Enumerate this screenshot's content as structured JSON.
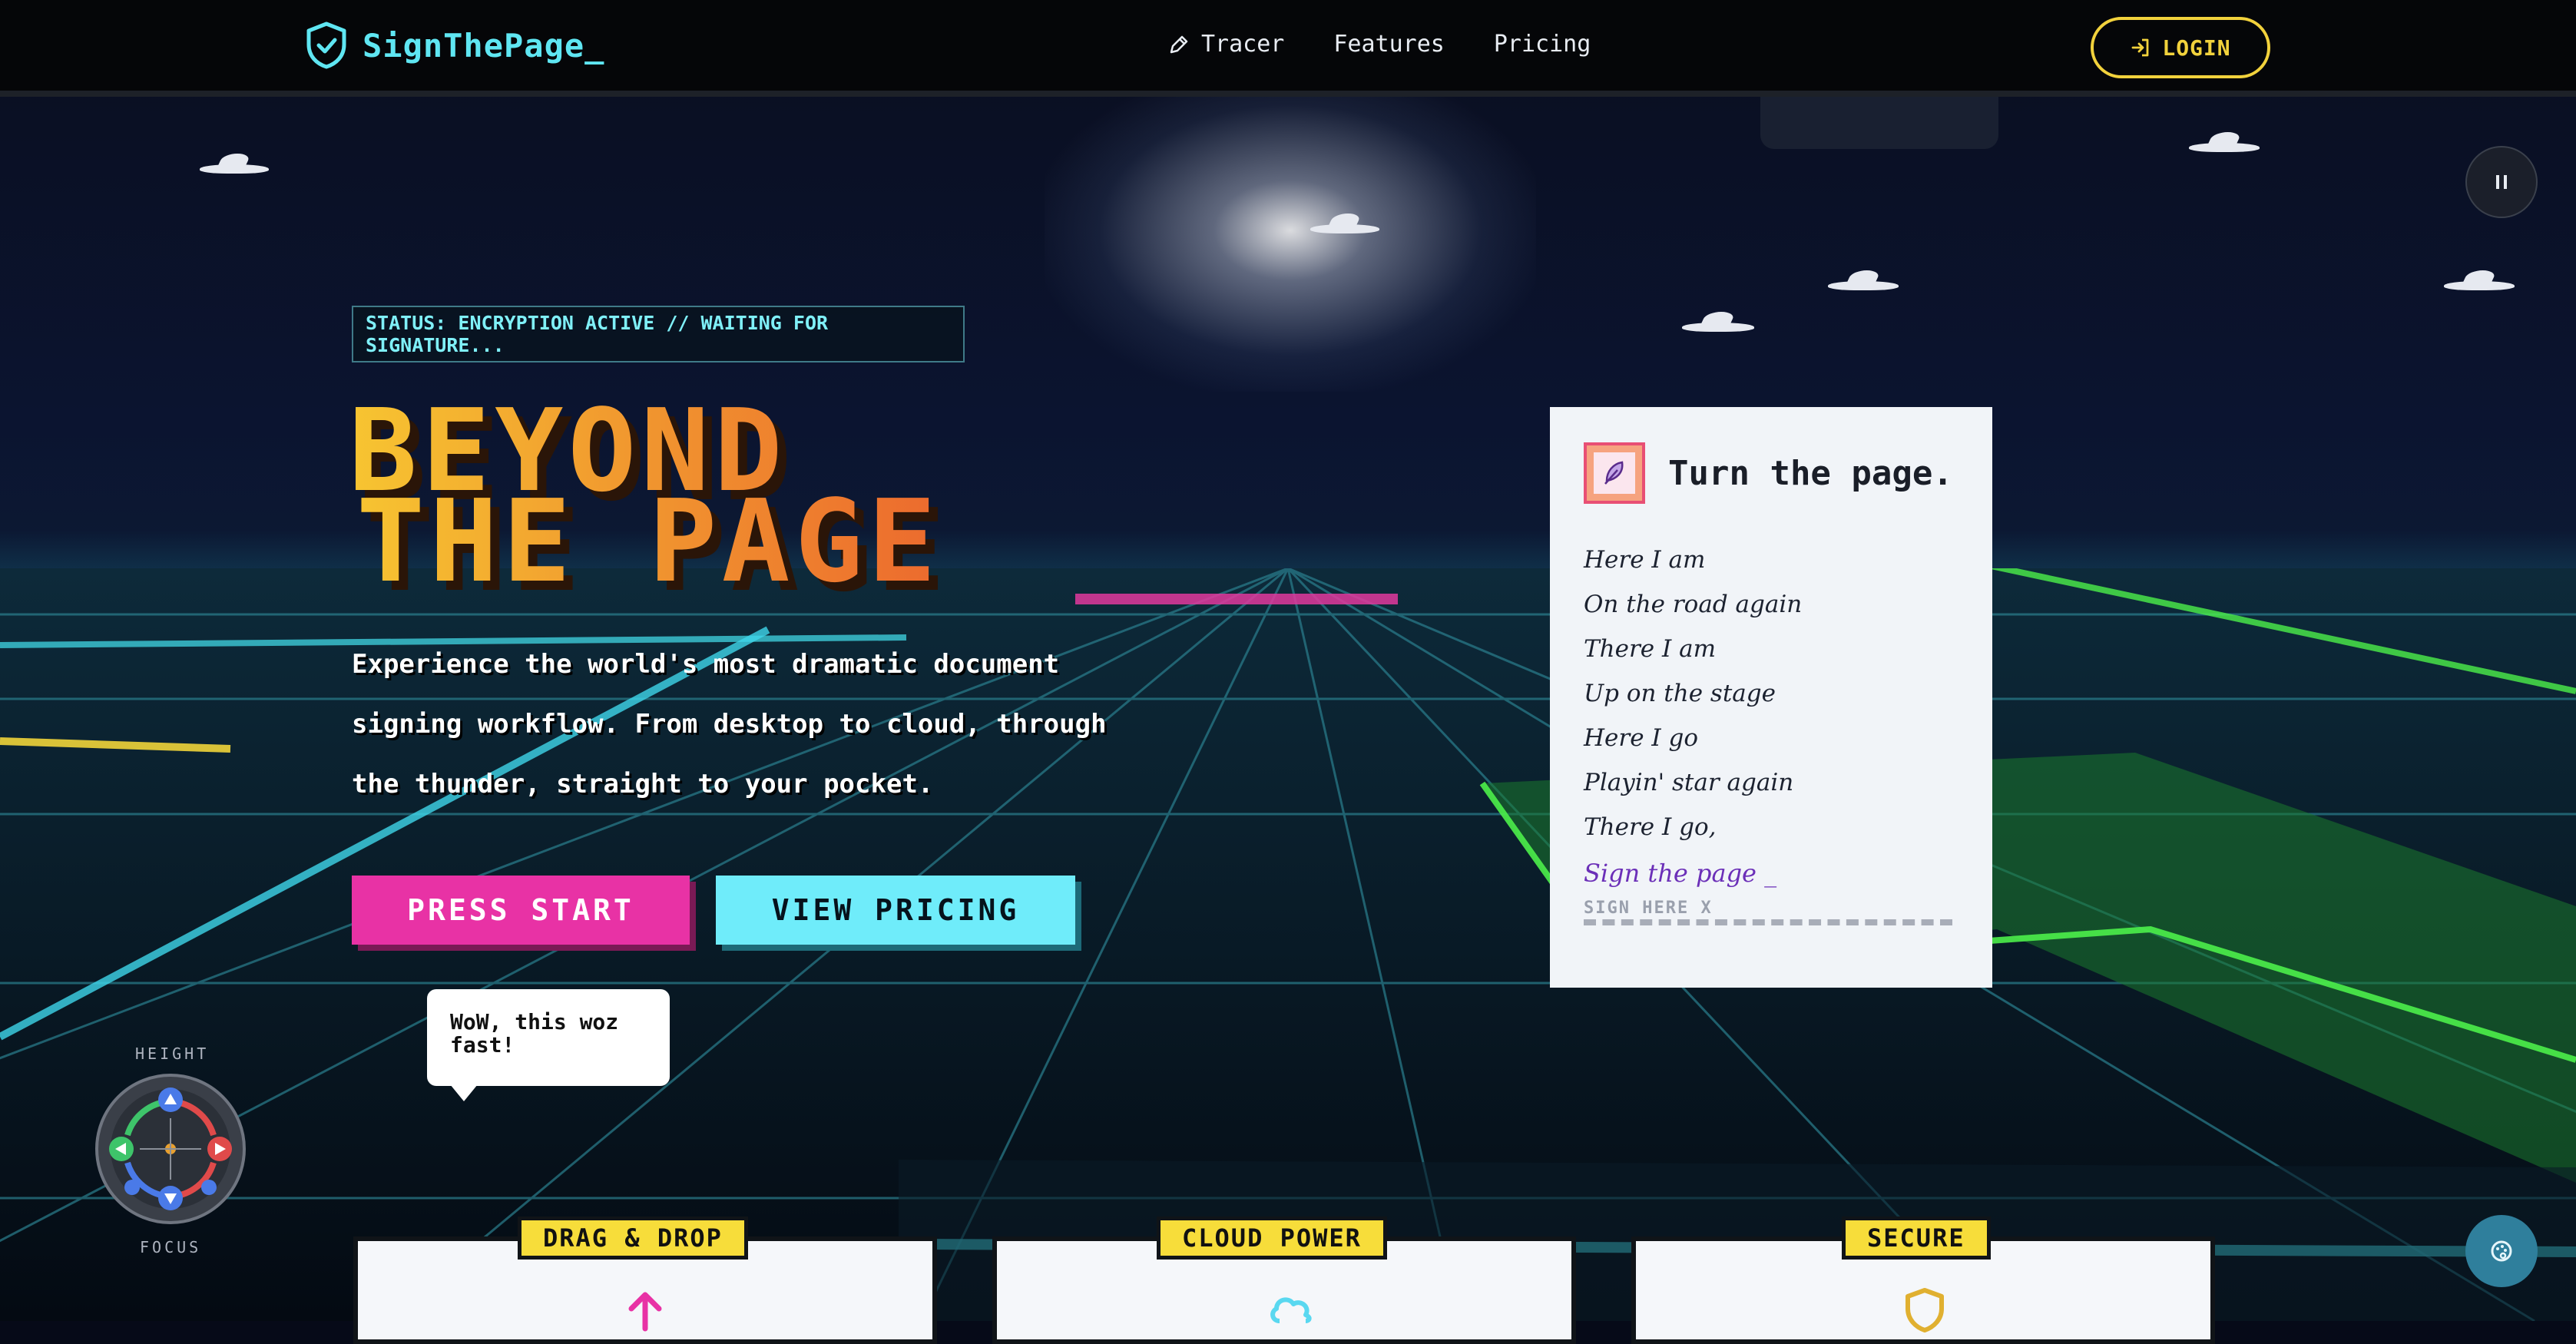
{
  "nav": {
    "brand": "SignThePage_",
    "links": [
      {
        "label": "Tracer",
        "icon": "pen-icon"
      },
      {
        "label": "Features"
      },
      {
        "label": "Pricing"
      }
    ],
    "login_label": "LOGIN"
  },
  "hero": {
    "status": "STATUS: ENCRYPTION ACTIVE // WAITING FOR SIGNATURE...",
    "title_line1": "BEYOND",
    "title_line2": "THE PAGE",
    "description": "Experience the world's most dramatic document signing workflow. From desktop to cloud, through the thunder, straight to your pocket.",
    "primary_button": "PRESS START",
    "secondary_button": "VIEW PRICING",
    "bubble": "WoW, this woz fast!"
  },
  "card": {
    "title": "Turn the page.",
    "poem": [
      "Here I am",
      "On the road again",
      "There I am",
      "Up on the stage",
      "Here I go",
      "Playin' star again",
      "There I go,"
    ],
    "sign_line": "Sign the page _",
    "sign_here": "SIGN HERE X"
  },
  "controls": {
    "height_label": "HEIGHT",
    "focus_label": "FOCUS"
  },
  "features": [
    {
      "label": "DRAG & DROP",
      "icon": "arrow-up-icon",
      "color": "#e832a5"
    },
    {
      "label": "CLOUD POWER",
      "icon": "cloud-icon",
      "color": "#59d8f0"
    },
    {
      "label": "SECURE",
      "icon": "shield-icon",
      "color": "#e0b030"
    }
  ],
  "colors": {
    "brand_cyan": "#5fe6f2",
    "accent_yellow": "#f2d23c",
    "accent_pink": "#e832a5",
    "accent_cyan": "#6fecfa"
  }
}
